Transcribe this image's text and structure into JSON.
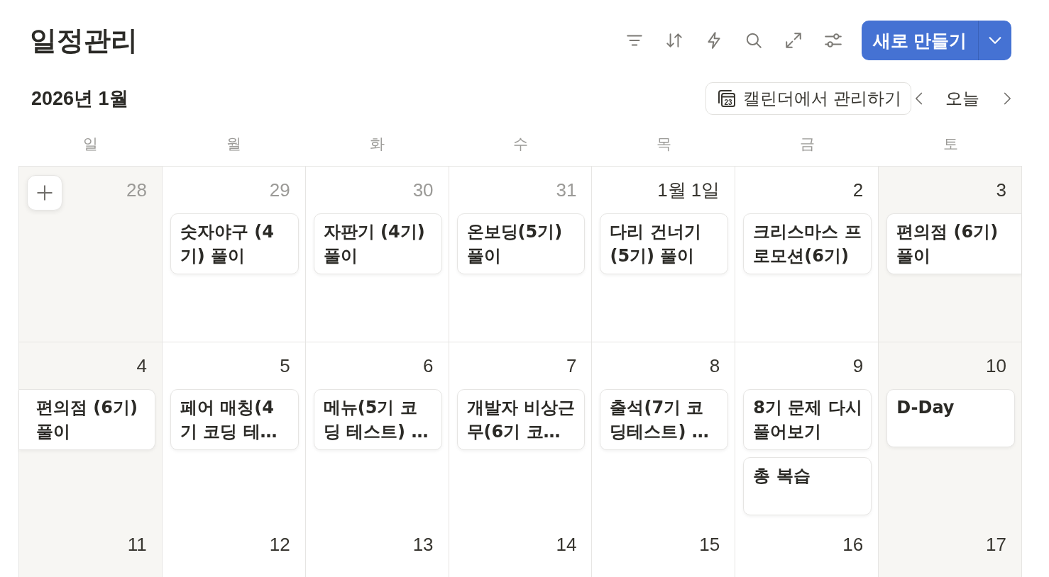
{
  "page": {
    "title": "일정관리"
  },
  "toolbar": {
    "new_button": {
      "label": "새로 만들기"
    }
  },
  "calendar": {
    "month_label": "2026년 1월",
    "manage_button": {
      "label": "캘린더에서 관리하기",
      "icon_text": "23"
    },
    "today_button": {
      "label": "오늘"
    },
    "weekdays": [
      "일",
      "월",
      "화",
      "수",
      "목",
      "금",
      "토"
    ],
    "weeks": [
      {
        "days": [
          {
            "label": "28",
            "other_month": true,
            "hovered": true
          },
          {
            "label": "29",
            "other_month": true,
            "hovered": false,
            "events": [
              {
                "title": "숫자야구 (4기) 풀이",
                "continues_before": false,
                "continues_after": false
              }
            ]
          },
          {
            "label": "30",
            "other_month": true,
            "hovered": false,
            "events": [
              {
                "title": "자판기 (4기) 풀이",
                "continues_before": false,
                "continues_after": false
              }
            ]
          },
          {
            "label": "31",
            "other_month": true,
            "hovered": false,
            "events": [
              {
                "title": "온보딩(5기) 풀이",
                "continues_before": false,
                "continues_after": false
              }
            ]
          },
          {
            "label": "1월 1일",
            "other_month": false,
            "hovered": false,
            "events": [
              {
                "title": "다리 건너기 (5기) 풀이",
                "continues_before": false,
                "continues_after": false
              }
            ]
          },
          {
            "label": "2",
            "other_month": false,
            "hovered": false,
            "events": [
              {
                "title": "크리스마스 프로모션(6기)",
                "continues_before": false,
                "continues_after": false
              }
            ]
          },
          {
            "label": "3",
            "other_month": false,
            "hovered": false,
            "events": [
              {
                "title": "편의점 (6기) 풀이",
                "continues_before": false,
                "continues_after": true
              }
            ]
          }
        ]
      },
      {
        "days": [
          {
            "label": "4",
            "other_month": false,
            "hovered": false,
            "events": [
              {
                "title": "편의점 (6기) 풀이",
                "continues_before": true,
                "continues_after": false
              }
            ]
          },
          {
            "label": "5",
            "other_month": false,
            "hovered": false,
            "events": [
              {
                "title": "페어 매칭(4기 코딩 테…",
                "continues_before": false,
                "continues_after": false
              }
            ]
          },
          {
            "label": "6",
            "other_month": false,
            "hovered": false,
            "events": [
              {
                "title": "메뉴(5기 코딩 테스트) …",
                "continues_before": false,
                "continues_after": false
              }
            ]
          },
          {
            "label": "7",
            "other_month": false,
            "hovered": false,
            "events": [
              {
                "title": "개발자 비상근무(6기 코…",
                "continues_before": false,
                "continues_after": false
              }
            ]
          },
          {
            "label": "8",
            "other_month": false,
            "hovered": false,
            "events": [
              {
                "title": "출석(7기 코딩테스트) …",
                "continues_before": false,
                "continues_after": false
              }
            ]
          },
          {
            "label": "9",
            "other_month": false,
            "hovered": false,
            "events": [
              {
                "title": "8기 문제 다시 풀어보기",
                "continues_before": false,
                "continues_after": false
              },
              {
                "title": "총 복습",
                "continues_before": false,
                "continues_after": false
              }
            ]
          },
          {
            "label": "10",
            "other_month": false,
            "hovered": false,
            "events": [
              {
                "title": "D-Day",
                "continues_before": false,
                "continues_after": false
              }
            ]
          }
        ]
      },
      {
        "days": [
          {
            "label": "11",
            "other_month": false,
            "hovered": false
          },
          {
            "label": "12",
            "other_month": false,
            "hovered": false
          },
          {
            "label": "13",
            "other_month": false,
            "hovered": false
          },
          {
            "label": "14",
            "other_month": false,
            "hovered": false
          },
          {
            "label": "15",
            "other_month": false,
            "hovered": false
          },
          {
            "label": "16",
            "other_month": false,
            "hovered": false
          },
          {
            "label": "17",
            "other_month": false,
            "hovered": false
          }
        ]
      }
    ]
  }
}
